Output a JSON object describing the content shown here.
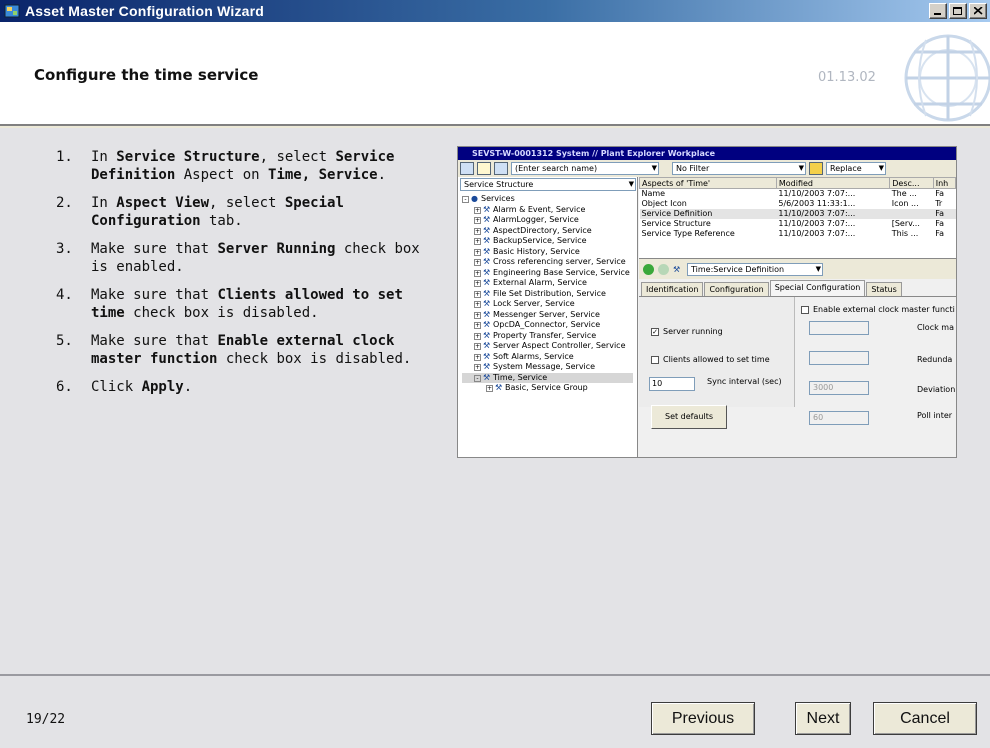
{
  "window": {
    "title": "Asset Master  Configuration Wizard"
  },
  "header": {
    "title": "Configure the time service",
    "code": "01.13.02"
  },
  "steps": [
    {
      "num": "1.",
      "parts": [
        [
          "In ",
          0
        ],
        [
          "Service Structure",
          1
        ],
        [
          ", select ",
          0
        ],
        [
          "Service Definition",
          1
        ],
        [
          " Aspect on ",
          0
        ],
        [
          "Time, Service",
          1
        ],
        [
          ".",
          0
        ]
      ]
    },
    {
      "num": "2.",
      "parts": [
        [
          "In ",
          0
        ],
        [
          "Aspect View",
          1
        ],
        [
          ", select ",
          0
        ],
        [
          "Special Configuration",
          1
        ],
        [
          " tab.",
          0
        ]
      ]
    },
    {
      "num": "3.",
      "parts": [
        [
          "Make sure that ",
          0
        ],
        [
          "Server Running",
          1
        ],
        [
          " check box is enabled.",
          0
        ]
      ]
    },
    {
      "num": "4.",
      "parts": [
        [
          "Make sure that ",
          0
        ],
        [
          "Clients allowed to set time",
          1
        ],
        [
          " check box is disabled.",
          0
        ]
      ]
    },
    {
      "num": "5.",
      "parts": [
        [
          "Make sure that ",
          0
        ],
        [
          "Enable external clock master function",
          1
        ],
        [
          " check box is disabled.",
          0
        ]
      ]
    },
    {
      "num": "6.",
      "parts": [
        [
          "Click ",
          0
        ],
        [
          "Apply",
          1
        ],
        [
          ".",
          0
        ]
      ]
    }
  ],
  "screenshot": {
    "title": "SEVST-W-0001312 System // Plant Explorer Workplace",
    "search_placeholder": "(Enter search name)",
    "filter": "No Filter",
    "replace": "Replace",
    "structure": "Service Structure",
    "tree": [
      "Services",
      "Alarm & Event, Service",
      "AlarmLogger, Service",
      "AspectDirectory, Service",
      "BackupService, Service",
      "Basic History, Service",
      "Cross referencing server, Service",
      "Engineering Base Service, Service",
      "External Alarm, Service",
      "File Set Distribution, Service",
      "Lock Server, Service",
      "Messenger Server, Service",
      "OpcDA_Connector, Service",
      "Property Transfer, Service",
      "Server Aspect Controller, Service",
      "Soft Alarms, Service",
      "System Message, Service",
      "Time, Service",
      "Basic, Service Group"
    ],
    "grid_headers": [
      "Aspects of 'Time'",
      "Modified",
      "Desc...",
      "Inh"
    ],
    "grid_rows": [
      [
        "Name",
        "11/10/2003 7:07:...",
        "The ...",
        "Fa"
      ],
      [
        "Object Icon",
        "5/6/2003 11:33:1...",
        "Icon ...",
        "Tr"
      ],
      [
        "Service Definition",
        "11/10/2003 7:07:...",
        "",
        "Fa"
      ],
      [
        "Service Structure",
        "11/10/2003 7:07:...",
        "[Serv...",
        "Fa"
      ],
      [
        "Service Type Reference",
        "11/10/2003 7:07:...",
        "This ...",
        "Fa"
      ]
    ],
    "aspect_path": "Time:Service Definition",
    "tabs": [
      "Identification",
      "Configuration",
      "Special Configuration",
      "Status"
    ],
    "server_running": "Server running",
    "clients_allowed": "Clients allowed to set time",
    "sync_value": "10",
    "sync_label": "Sync interval (sec)",
    "set_defaults": "Set defaults",
    "ext_clock": "Enable external clock master functi",
    "clock_ma": "Clock ma",
    "redund": "Redunda",
    "deviation": "Deviation",
    "deviation_value": "3000",
    "poll": "Poll inter",
    "poll_value": "60"
  },
  "footer": {
    "page": "19/22",
    "previous": "Previous",
    "next": "Next",
    "cancel": "Cancel"
  }
}
